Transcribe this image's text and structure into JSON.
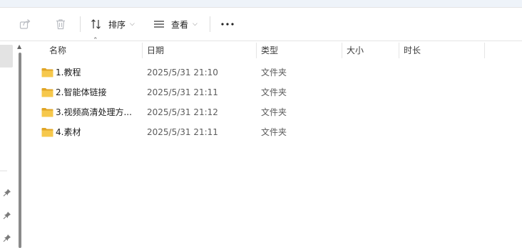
{
  "toolbar": {
    "share_icon": "share-icon",
    "delete_icon": "trash-icon",
    "sort_label": "排序",
    "view_label": "查看",
    "more_icon": "more-icon"
  },
  "columns": {
    "name": "名称",
    "date": "日期",
    "type": "类型",
    "size": "大小",
    "duration": "时长"
  },
  "files": [
    {
      "name": "1.教程",
      "date": "2025/5/31 21:10",
      "type": "文件夹",
      "size": "",
      "duration": ""
    },
    {
      "name": "2.智能体链接",
      "date": "2025/5/31 21:11",
      "type": "文件夹",
      "size": "",
      "duration": ""
    },
    {
      "name": "3.视频高清处理方...",
      "date": "2025/5/31 21:12",
      "type": "文件夹",
      "size": "",
      "duration": ""
    },
    {
      "name": "4.素材",
      "date": "2025/5/31 21:11",
      "type": "文件夹",
      "size": "",
      "duration": ""
    }
  ],
  "colors": {
    "folder": "#f3c04a",
    "folder_dark": "#e0a526"
  }
}
